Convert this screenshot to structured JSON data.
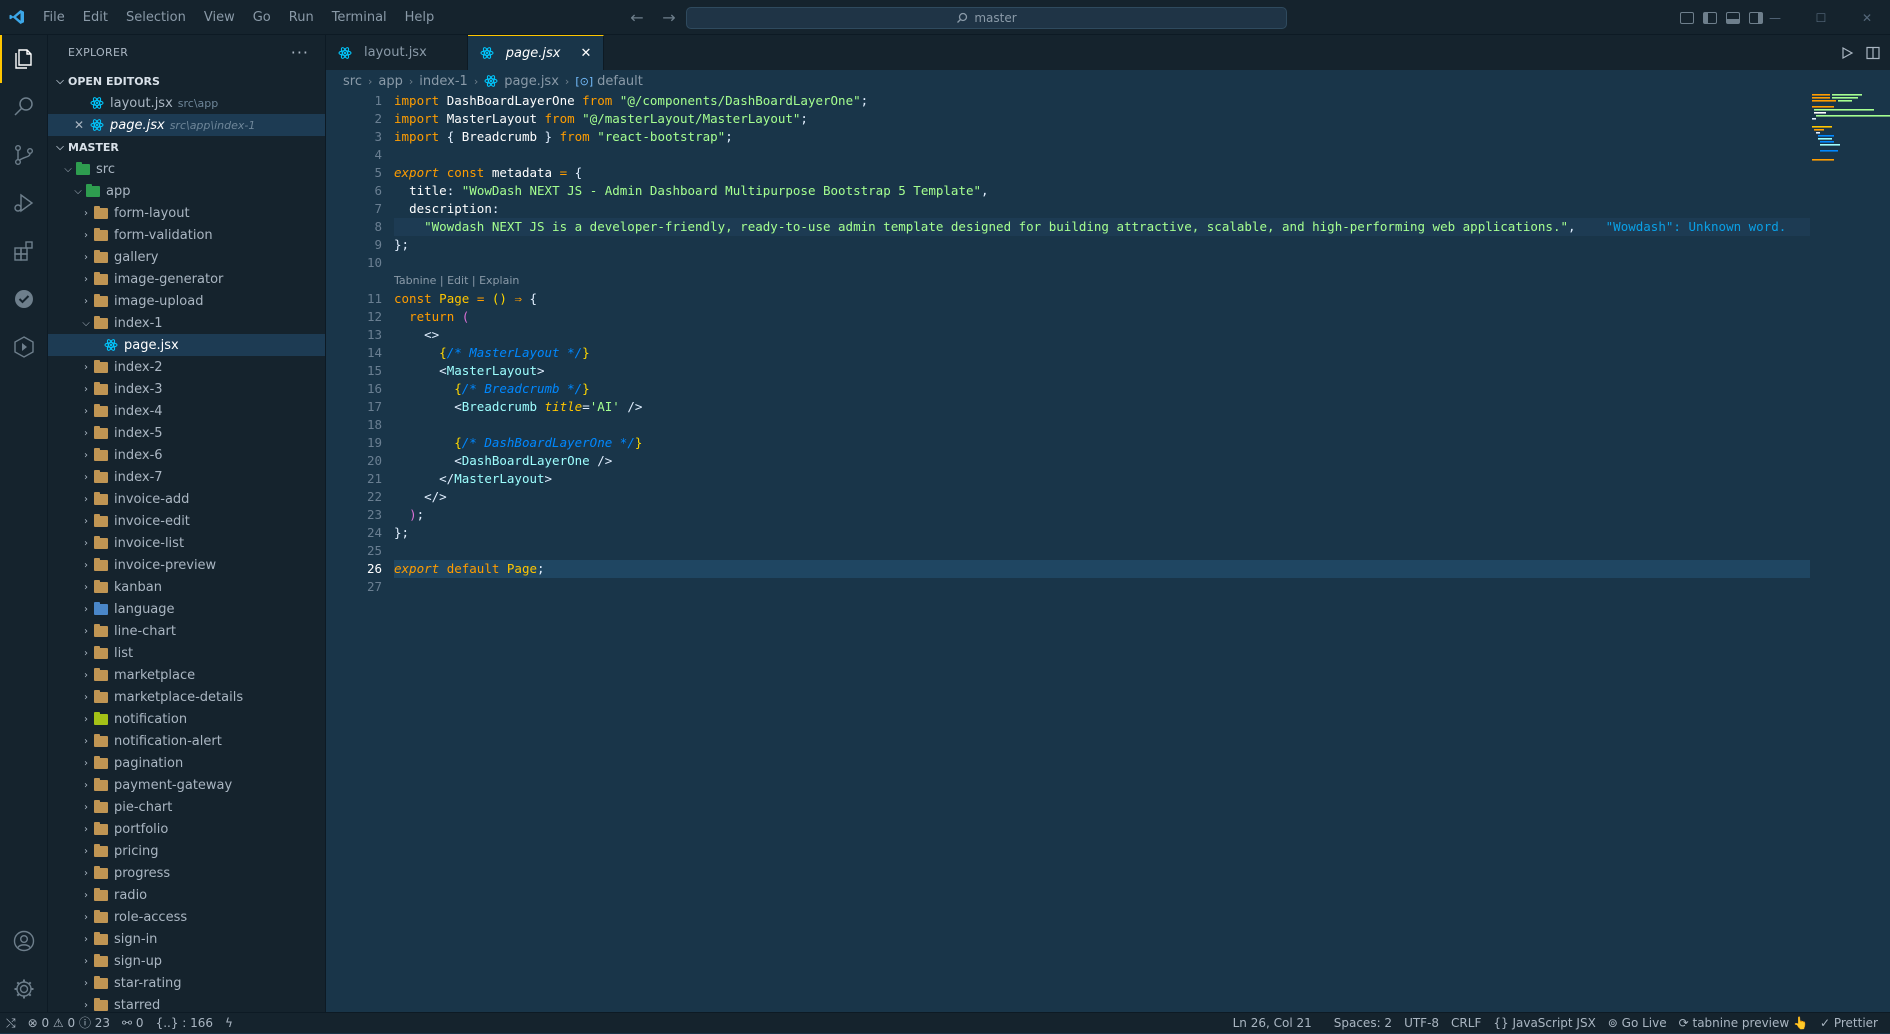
{
  "titlebar": {
    "menus": [
      "File",
      "Edit",
      "Selection",
      "View",
      "Go",
      "Run",
      "Terminal",
      "Help"
    ],
    "search_text": "master"
  },
  "activity": {
    "icons": [
      "explorer-icon",
      "search-icon",
      "source-control-icon",
      "run-debug-icon",
      "extensions-icon",
      "testing-icon",
      "deploy-icon",
      "account-icon",
      "settings-gear-icon"
    ]
  },
  "sidebar": {
    "title": "EXPLORER",
    "open_editors_title": "OPEN EDITORS",
    "open_editors": [
      {
        "name": "layout.jsx",
        "path": "src\\app"
      },
      {
        "name": "page.jsx",
        "path": "src\\app\\index-1"
      }
    ],
    "workspace_title": "MASTER",
    "tree": [
      {
        "label": "src",
        "depth": 1,
        "open": true,
        "icon": "green"
      },
      {
        "label": "app",
        "depth": 2,
        "open": true,
        "icon": "green"
      },
      {
        "label": "form-layout",
        "depth": 3
      },
      {
        "label": "form-validation",
        "depth": 3
      },
      {
        "label": "gallery",
        "depth": 3
      },
      {
        "label": "image-generator",
        "depth": 3
      },
      {
        "label": "image-upload",
        "depth": 3
      },
      {
        "label": "index-1",
        "depth": 3,
        "open": true
      },
      {
        "label": "page.jsx",
        "depth": 4,
        "file": true,
        "selected": true
      },
      {
        "label": "index-2",
        "depth": 3
      },
      {
        "label": "index-3",
        "depth": 3
      },
      {
        "label": "index-4",
        "depth": 3
      },
      {
        "label": "index-5",
        "depth": 3
      },
      {
        "label": "index-6",
        "depth": 3
      },
      {
        "label": "index-7",
        "depth": 3
      },
      {
        "label": "invoice-add",
        "depth": 3
      },
      {
        "label": "invoice-edit",
        "depth": 3
      },
      {
        "label": "invoice-list",
        "depth": 3
      },
      {
        "label": "invoice-preview",
        "depth": 3
      },
      {
        "label": "kanban",
        "depth": 3
      },
      {
        "label": "language",
        "depth": 3,
        "icon": "blue"
      },
      {
        "label": "line-chart",
        "depth": 3
      },
      {
        "label": "list",
        "depth": 3
      },
      {
        "label": "marketplace",
        "depth": 3
      },
      {
        "label": "marketplace-details",
        "depth": 3
      },
      {
        "label": "notification",
        "depth": 3,
        "icon": "lime"
      },
      {
        "label": "notification-alert",
        "depth": 3
      },
      {
        "label": "pagination",
        "depth": 3
      },
      {
        "label": "payment-gateway",
        "depth": 3
      },
      {
        "label": "pie-chart",
        "depth": 3
      },
      {
        "label": "portfolio",
        "depth": 3
      },
      {
        "label": "pricing",
        "depth": 3
      },
      {
        "label": "progress",
        "depth": 3
      },
      {
        "label": "radio",
        "depth": 3
      },
      {
        "label": "role-access",
        "depth": 3
      },
      {
        "label": "sign-in",
        "depth": 3
      },
      {
        "label": "sign-up",
        "depth": 3
      },
      {
        "label": "star-rating",
        "depth": 3
      },
      {
        "label": "starred",
        "depth": 3
      }
    ]
  },
  "tabs": [
    {
      "label": "layout.jsx",
      "active": false
    },
    {
      "label": "page.jsx",
      "active": true
    }
  ],
  "breadcrumb": [
    "src",
    "app",
    "index-1",
    "page.jsx",
    "default"
  ],
  "editor": {
    "codelens": "Tabnine | Edit | Explain",
    "current_line": 26,
    "lines": [
      {
        "n": 1,
        "html": "<span class='kw'>import</span> <span class='ident'>DashBoardLayerOne</span> <span class='kw'>from</span> <span class='str'>\"@/components/DashBoardLayerOne\"</span><span class='punc'>;</span>"
      },
      {
        "n": 2,
        "html": "<span class='kw'>import</span> <span class='ident'>MasterLayout</span> <span class='kw'>from</span> <span class='str'>\"@/masterLayout/MasterLayout\"</span><span class='punc'>;</span>"
      },
      {
        "n": 3,
        "html": "<span class='kw'>import</span> <span class='punc'>{</span> <span class='ident'>Breadcrumb</span> <span class='punc'>}</span> <span class='kw'>from</span> <span class='str'>\"react-bootstrap\"</span><span class='punc'>;</span>"
      },
      {
        "n": 4,
        "html": ""
      },
      {
        "n": 5,
        "html": "<span class='kwi'>export</span> <span class='kw'>const</span> <span class='ident'>metadata</span> <span class='kw'>=</span> <span class='punc'>{</span>"
      },
      {
        "n": 6,
        "html": "  <span class='ident'>title</span><span class='punc'>:</span> <span class='str'>\"WowDash NEXT JS - Admin Dashboard Multipurpose Bootstrap 5 Template\"</span><span class='punc'>,</span>"
      },
      {
        "n": 7,
        "html": "  <span class='ident'>description</span><span class='punc'>:</span>"
      },
      {
        "n": 8,
        "html": "    <span class='str'>\"Wowdash NEXT JS is a developer-friendly, ready-to-use admin template designed for building attractive, scalable, and high-performing web applications.\"</span><span class='punc'>,</span>    <span class='inlay'>\"Wowdash\": Unknown word.</span>",
        "wrap": true
      },
      {
        "n": 9,
        "html": "<span class='punc'>};</span>"
      },
      {
        "n": 10,
        "html": ""
      },
      {
        "n": 11,
        "html": "<span class='kw'>const</span> <span class='fn'>Page</span> <span class='kw'>=</span> <span class='brk1'>()</span> <span class='kw'>⇒</span> <span class='punc'>{</span>",
        "lens": true
      },
      {
        "n": 12,
        "html": "  <span class='kw'>return</span> <span class='brk2'>(</span>"
      },
      {
        "n": 13,
        "html": "    <span class='jsxbr'>&lt;&gt;</span>"
      },
      {
        "n": 14,
        "html": "      <span class='brk1'>{</span><span class='cmt'>/* MasterLayout */</span><span class='brk1'>}</span>"
      },
      {
        "n": 15,
        "html": "      <span class='jsxbr'>&lt;</span><span class='tag'>MasterLayout</span><span class='jsxbr'>&gt;</span>"
      },
      {
        "n": 16,
        "html": "        <span class='brk1'>{</span><span class='cmt'>/* Breadcrumb */</span><span class='brk1'>}</span>"
      },
      {
        "n": 17,
        "html": "        <span class='jsxbr'>&lt;</span><span class='tag'>Breadcrumb</span> <span class='attr'>title</span><span class='punc'>=</span><span class='str'>'AI'</span> <span class='jsxbr'>/&gt;</span>"
      },
      {
        "n": 18,
        "html": ""
      },
      {
        "n": 19,
        "html": "        <span class='brk1'>{</span><span class='cmt'>/* DashBoardLayerOne */</span><span class='brk1'>}</span>"
      },
      {
        "n": 20,
        "html": "        <span class='jsxbr'>&lt;</span><span class='tag'>DashBoardLayerOne</span> <span class='jsxbr'>/&gt;</span>"
      },
      {
        "n": 21,
        "html": "      <span class='jsxbr'>&lt;/</span><span class='tag'>MasterLayout</span><span class='jsxbr'>&gt;</span>"
      },
      {
        "n": 22,
        "html": "    <span class='jsxbr'>&lt;/&gt;</span>"
      },
      {
        "n": 23,
        "html": "  <span class='brk2'>)</span><span class='punc'>;</span>"
      },
      {
        "n": 24,
        "html": "<span class='punc'>};</span>"
      },
      {
        "n": 25,
        "html": ""
      },
      {
        "n": 26,
        "html": "<span class='kwi'>export</span> <span class='kw'>default</span> <span class='fn'>Page</span><span class='punc'>;</span>"
      },
      {
        "n": 27,
        "html": ""
      }
    ]
  },
  "status": {
    "problems": "⊗ 0 ⚠ 0 ⓘ 23",
    "ports": "⚯ 0",
    "symbols": "{..} : 166",
    "position": "Ln 26, Col 21",
    "spaces": "Spaces: 2",
    "encoding": "UTF-8",
    "eol": "CRLF",
    "language": "{} JavaScript JSX",
    "golive": "⊚ Go Live",
    "tabnine": "⟳ tabnine preview 👆",
    "prettier": "✓ Prettier"
  },
  "colors": {
    "accent": "#ffc600",
    "editor_bg": "#193549",
    "sidebar_bg": "#15232d"
  }
}
